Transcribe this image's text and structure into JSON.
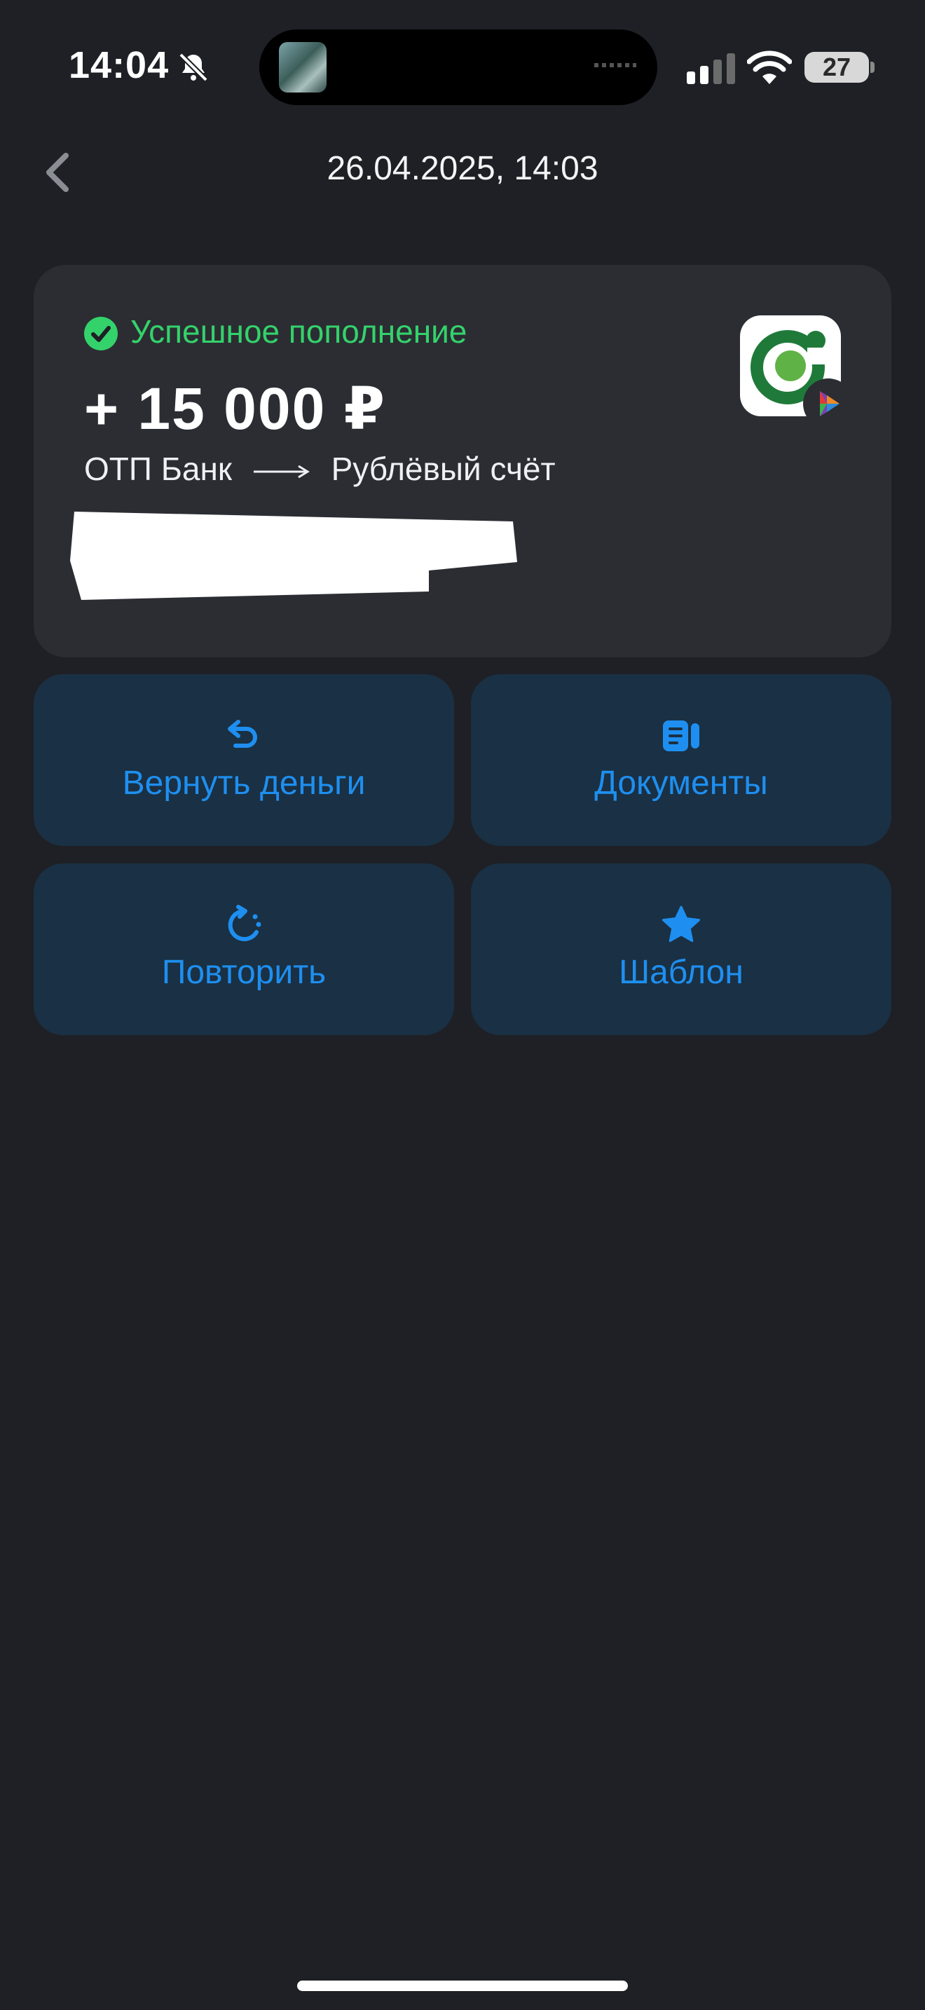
{
  "status_bar": {
    "time": "14:04",
    "battery": "27",
    "icons": [
      "bell-slash-icon",
      "signal-icon",
      "wifi-icon",
      "battery-icon"
    ]
  },
  "header": {
    "title": "26.04.2025, 14:03",
    "back_icon": "chevron-left-icon"
  },
  "transaction": {
    "status": "Успешное пополнение",
    "amount": "+ 15 000 ₽",
    "from": "ОТП Банк",
    "to": "Рублёвый счёт",
    "status_color": "#34d26b"
  },
  "actions": [
    {
      "label": "Вернуть деньги",
      "icon": "undo-arrow-icon"
    },
    {
      "label": "Документы",
      "icon": "documents-icon"
    },
    {
      "label": "Повторить",
      "icon": "repeat-icon"
    },
    {
      "label": "Шаблон",
      "icon": "star-icon"
    }
  ],
  "colors": {
    "background": "#1e2025",
    "card": "#2b2d33",
    "tile": "#1a3044",
    "accent": "#1e8ff0",
    "bank_logo": "#1f7a3a"
  }
}
